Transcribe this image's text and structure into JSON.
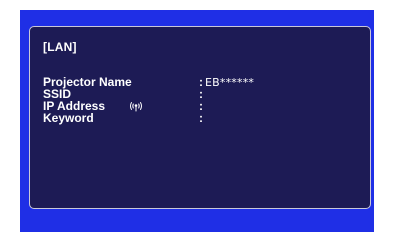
{
  "lan_panel": {
    "title": "[LAN]",
    "rows": [
      {
        "label": "Projector Name",
        "separator": ":",
        "value": "EB******"
      },
      {
        "label": "SSID",
        "separator": ":",
        "value": ""
      },
      {
        "label": "IP Address",
        "separator": ":",
        "value": ""
      },
      {
        "label": "Keyword",
        "separator": ":",
        "value": ""
      }
    ],
    "wireless_icon": "wireless-signal-icon"
  },
  "colors": {
    "screen_background": "#1f2fe6",
    "panel_background": "#1d1b55",
    "panel_border": "#c9c8d8",
    "text": "#ffffff"
  }
}
